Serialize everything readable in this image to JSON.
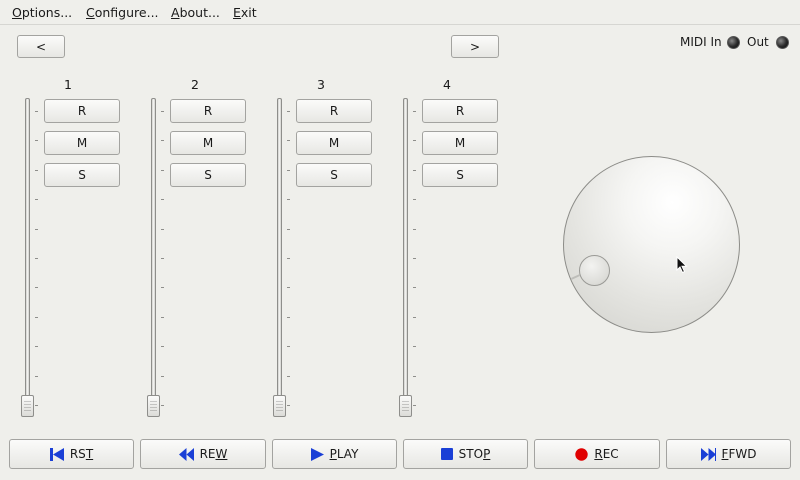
{
  "menu": [
    {
      "label_u": "O",
      "label_rest": "ptions..."
    },
    {
      "label_u": "C",
      "label_rest": "onfigure..."
    },
    {
      "label_u": "A",
      "label_rest": "bout..."
    },
    {
      "label_u": "E",
      "label_rest": "xit"
    }
  ],
  "nav": {
    "prev_label": "<",
    "next_label": ">"
  },
  "midi": {
    "in_label": "MIDI In",
    "out_label": "Out"
  },
  "tracks": [
    {
      "number": "1",
      "r": "R",
      "m": "M",
      "s": "S"
    },
    {
      "number": "2",
      "r": "R",
      "m": "M",
      "s": "S"
    },
    {
      "number": "3",
      "r": "R",
      "m": "M",
      "s": "S"
    },
    {
      "number": "4",
      "r": "R",
      "m": "M",
      "s": "S"
    }
  ],
  "transport": [
    {
      "pre": "",
      "u": "",
      "post": "",
      "full": "RST",
      "icon": "skip-to-start-icon",
      "u_index": 2
    },
    {
      "pre": "",
      "u": "",
      "post": "",
      "full": "REW",
      "icon": "rewind-icon",
      "u_index": 2
    },
    {
      "pre": "",
      "u": "",
      "post": "",
      "full": "PLAY",
      "icon": "play-icon",
      "u_index": 0
    },
    {
      "pre": "",
      "u": "",
      "post": "",
      "full": "STOP",
      "icon": "stop-icon",
      "u_index": 3
    },
    {
      "pre": "",
      "u": "",
      "post": "",
      "full": "REC",
      "icon": "record-icon",
      "u_index": 0
    },
    {
      "pre": "",
      "u": "",
      "post": "",
      "full": "FFWD",
      "icon": "fast-forward-icon",
      "u_index": 0
    }
  ],
  "transport_labels": {
    "rst": {
      "a": "RS",
      "b": "T",
      "c": ""
    },
    "rew": {
      "a": "RE",
      "b": "W",
      "c": ""
    },
    "play": {
      "a": "",
      "b": "P",
      "c": "LAY"
    },
    "stop": {
      "a": "STO",
      "b": "P",
      "c": ""
    },
    "rec": {
      "a": "",
      "b": "R",
      "c": "EC"
    },
    "ffwd": {
      "a": "",
      "b": "F",
      "c": "FWD"
    }
  },
  "faders": [
    {
      "level": 0
    },
    {
      "level": 0
    },
    {
      "level": 0
    },
    {
      "level": 0
    }
  ],
  "colors": {
    "icon_blue": "#1a3fd6",
    "record_red": "#e00000",
    "background": "#efefeb"
  }
}
